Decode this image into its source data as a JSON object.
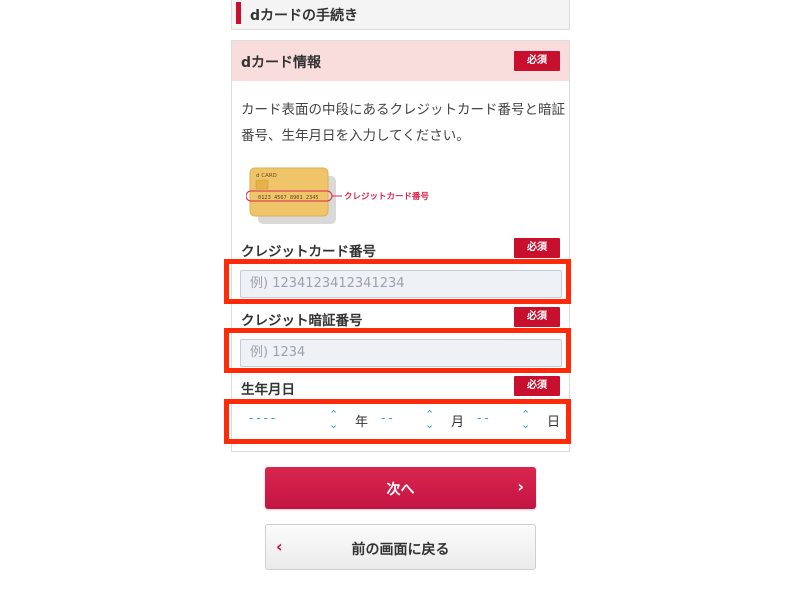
{
  "section_header": {
    "title": "dカードの手続き"
  },
  "panel": {
    "title": "dカード情報",
    "required_label": "必須",
    "description": "カード表面の中段にあるクレジットカード番号と暗証番号、生年月日を入力してください。",
    "illustration": {
      "card_brand": "d CARD",
      "card_number": "0123 4567 8901 2345",
      "caption": "クレジットカード番号"
    }
  },
  "fields": {
    "card_number": {
      "label": "クレジットカード番号",
      "placeholder": "例) 1234123412341234",
      "required_label": "必須"
    },
    "pin": {
      "label": "クレジット暗証番号",
      "placeholder": "例) 1234",
      "required_label": "必須"
    },
    "birthdate": {
      "label": "生年月日",
      "required_label": "必須",
      "year": {
        "value": "----",
        "unit": "年"
      },
      "month": {
        "value": "--",
        "unit": "月"
      },
      "day": {
        "value": "--",
        "unit": "日"
      }
    }
  },
  "buttons": {
    "next": {
      "label": "次へ",
      "icon": "chevron-right-icon"
    },
    "back": {
      "label": "前の画面に戻る",
      "icon": "chevron-left-icon"
    }
  },
  "colors": {
    "accent": "#c8102e",
    "highlight": "#ff2a0a",
    "header_bg": "#f9dcdc"
  }
}
